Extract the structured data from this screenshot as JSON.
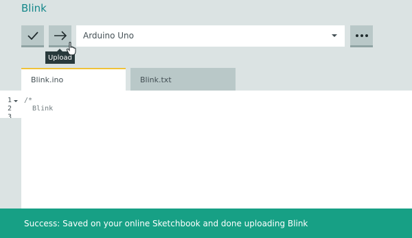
{
  "sketch": {
    "title": "Blink"
  },
  "toolbar": {
    "verify_icon": "checkmark-icon",
    "upload_icon": "arrow-right-icon",
    "more_icon": "ellipsis-icon",
    "board_selected": "Arduino Uno",
    "upload_tooltip": "Upload"
  },
  "tabs": [
    {
      "label": "Blink.ino",
      "active": true
    },
    {
      "label": "Blink.txt",
      "active": false
    }
  ],
  "editor": {
    "line_numbers": [
      "1",
      "2",
      "3"
    ],
    "lines": [
      "/*",
      "  Blink",
      ""
    ]
  },
  "notification": {
    "message": "Success: Saved on your online Sketchbook and done uploading Blink"
  },
  "colors": {
    "accent": "#14878a",
    "success": "#17a085",
    "active_tab_indicator": "#f0c238"
  }
}
